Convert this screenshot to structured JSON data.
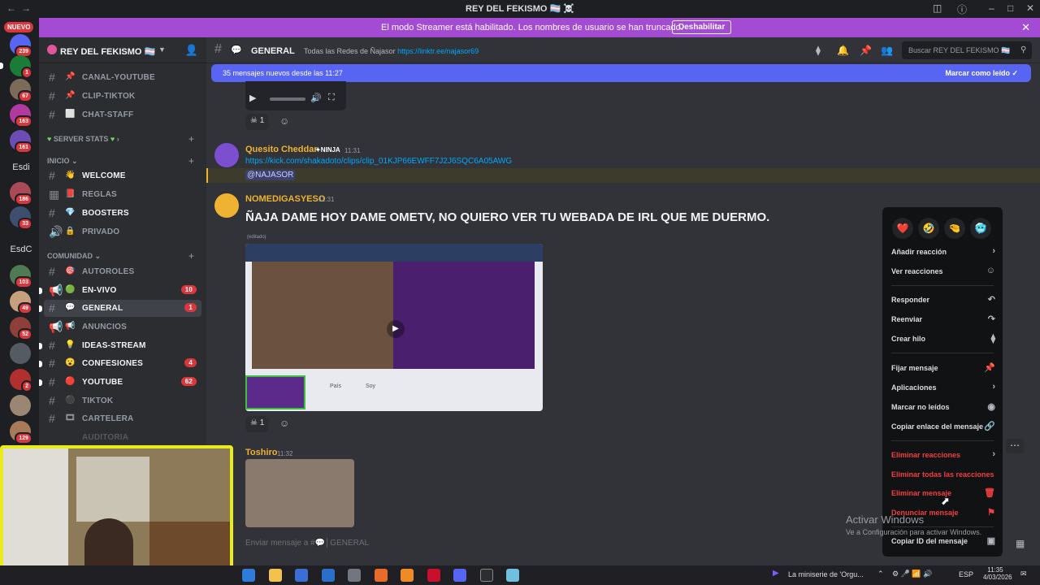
{
  "window": {
    "title": "REY DEL FEKISMO 🏳️‍⚧️ ☠️"
  },
  "rail": {
    "new_label": "NUEVO",
    "badges": [
      "239",
      "1",
      "67",
      "163",
      "161",
      "186",
      "33",
      "103",
      "49",
      "52",
      "2",
      "129"
    ],
    "text_servers": [
      "Esdi",
      "EsdC"
    ]
  },
  "banner": {
    "text": "El modo Streamer está habilitado. Los nombres de usuario se han truncado.",
    "button": "Deshabilitar"
  },
  "server": {
    "name": "REY DEL FEKISMO 🏳️‍⚧️",
    "channels_top": [
      {
        "emoji": "📌",
        "label": "CANAL-YOUTUBE"
      },
      {
        "emoji": "📌",
        "label": "CLIP-TIKTOK"
      },
      {
        "emoji": "⬜",
        "label": "CHAT-STAFF"
      }
    ],
    "cat_stats": "SERVER STATS",
    "cat_inicio": "INICIO",
    "channels_inicio": [
      {
        "emoji": "👋",
        "label": "WELCOME"
      },
      {
        "emoji": "📕",
        "label": "REGLAS"
      },
      {
        "emoji": "💎",
        "label": "BOOSTERS"
      },
      {
        "emoji": "🔒",
        "label": "PRIVADO"
      }
    ],
    "cat_comunidad": "COMUNIDAD",
    "channels_comunidad": [
      {
        "emoji": "🎯",
        "label": "AUTOROLES",
        "count": ""
      },
      {
        "emoji": "🟢",
        "label": "EN-VIVO",
        "count": "10"
      },
      {
        "emoji": "💬",
        "label": "GENERAL",
        "count": "1"
      },
      {
        "emoji": "📢",
        "label": "ANUNCIOS",
        "count": ""
      },
      {
        "emoji": "💡",
        "label": "IDEAS-STREAM",
        "count": ""
      },
      {
        "emoji": "😮",
        "label": "CONFESIONES",
        "count": "4"
      },
      {
        "emoji": "🔴",
        "label": "YOUTUBE",
        "count": "62"
      },
      {
        "emoji": "⚫",
        "label": "TIKTOK",
        "count": ""
      },
      {
        "emoji": "🎞",
        "label": "CARTELERA",
        "count": ""
      },
      {
        "emoji": "",
        "label": "AUDITORIA",
        "count": ""
      }
    ]
  },
  "topbar": {
    "channel": "GENERAL",
    "topic": "Todas las Redes de Ñajasor",
    "topic_link": "https://linktr.ee/najasor69",
    "search_placeholder": "Buscar REY DEL FEKISMO 🏳️‍⚧️"
  },
  "newbar": {
    "text": "35 mensajes nuevos desde las 11:27",
    "action": "Marcar como leído"
  },
  "messages": [
    {
      "author": "Quesito Cheddar",
      "tag": "NINJA",
      "time": "11:31",
      "link": "https://kick.com/shakadoto/clips/clip_01KJP66EWFF7J2J6SQC6A05AWG",
      "mention": "@NAJASOR"
    },
    {
      "author": "NOMEDIGASYESO",
      "time": "11:31",
      "text": "ÑAJA DAME HOY DAME OMETV, NO QUIERO VER TU WEBADA DE IRL QUE ME DUERMO.",
      "edited": "(editado)",
      "embed_labels": [
        "País",
        "Soy"
      ]
    },
    {
      "author": "Toshiro",
      "time": "11:32"
    }
  ],
  "reactions": {
    "first": "1",
    "second": "1"
  },
  "menu": {
    "quick": [
      "❤️",
      "🤣",
      "🤏",
      "🥶"
    ],
    "items": [
      "Añadir reacción",
      "Ver reacciones",
      "Responder",
      "Reenviar",
      "Crear hilo",
      "Fijar mensaje",
      "Aplicaciones",
      "Marcar no leídos",
      "Copiar enlace del mensaje",
      "Eliminar reacciones",
      "Eliminar todas las reacciones",
      "Eliminar mensaje",
      "Denunciar mensaje",
      "Copiar ID del mensaje"
    ]
  },
  "composer": {
    "placeholder": "Enviar mensaje a #💬│GENERAL"
  },
  "watermark": {
    "title": "Activar Windows",
    "sub": "Ve a Configuración para activar Windows."
  },
  "taskbar": {
    "media": "La miniserie de 'Orgu...",
    "lang": "ESP",
    "time": "11:35",
    "date": "4/03/2026"
  },
  "colors": {
    "accent": "#5865f2",
    "streamer": "#a44bd4",
    "danger": "#f23f42",
    "author_gold": "#f0b232",
    "webcam_border": "#e8ec1b"
  }
}
